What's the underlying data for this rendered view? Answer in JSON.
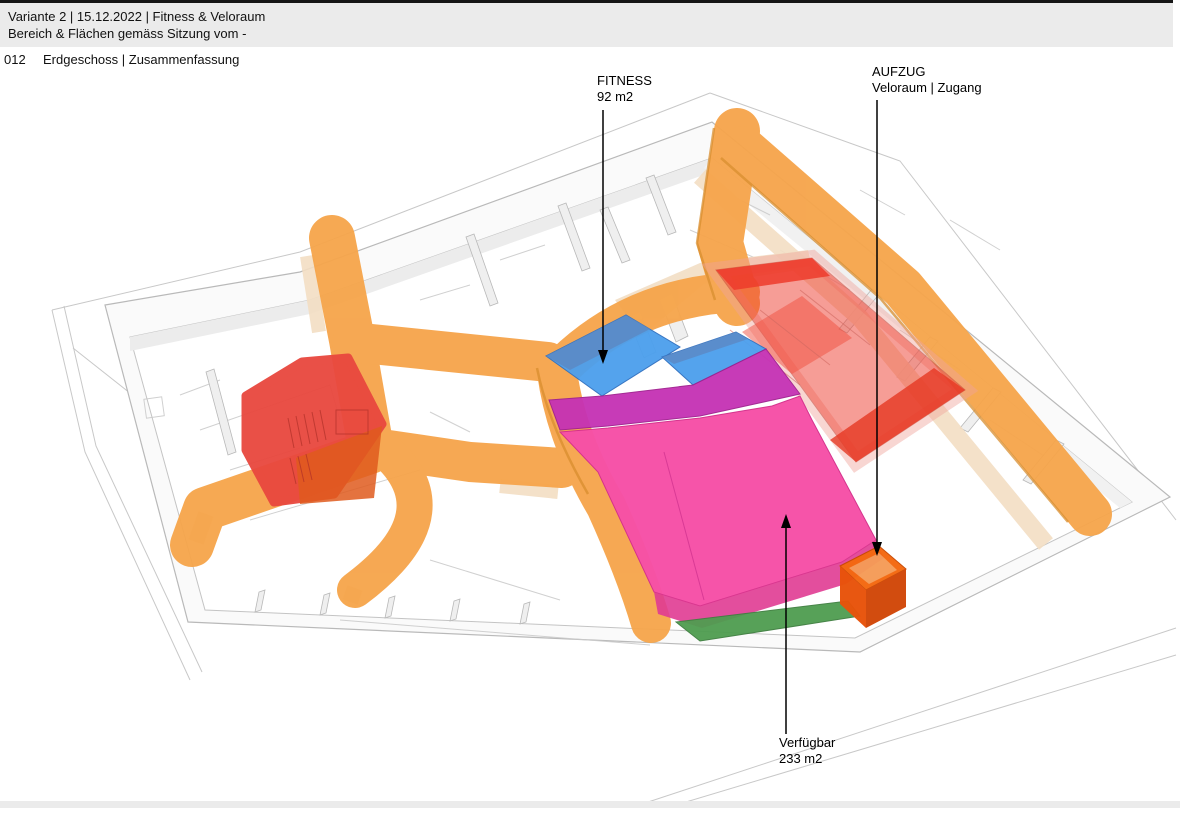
{
  "header": {
    "line1": "Variante 2 | 15.12.2022 | Fitness & Veloraum",
    "line2": "Bereich & Flächen gemäss Sitzung vom -",
    "doc_number": "012",
    "doc_title": "Erdgeschoss | Zusammenfassung"
  },
  "annotations": {
    "fitness": {
      "label": "FITNESS",
      "area": "92 m2"
    },
    "aufzug": {
      "label": "AUFZUG",
      "sub": "Veloraum | Zugang"
    },
    "verfuegbar": {
      "label": "Verfügbar",
      "area": "233 m2"
    }
  },
  "zone_colors": {
    "corridor_orange": "#F6A44A",
    "corridor_edge": "#D88E2F",
    "corridor_pale_wall": "#F3DEC3",
    "fitness_blue": "#4B9FED",
    "available_pink": "#F64FA7",
    "purple_zone": "#C531B4",
    "red_room_left": "#E8473E",
    "red_room_right": "#EE3D2E",
    "aufzug_orange": "#F05A0D",
    "green_zone": "#4F9C50",
    "header_bar": "#EBEBEB"
  }
}
